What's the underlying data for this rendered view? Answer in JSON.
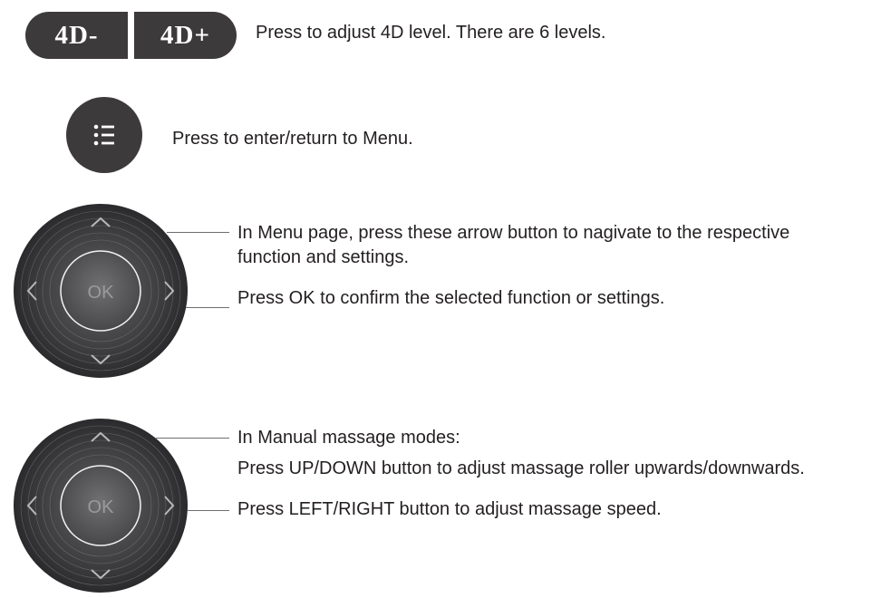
{
  "row_4d": {
    "minus_label": "4D-",
    "plus_label": "4D+",
    "description": "Press to adjust 4D level. There are 6 levels."
  },
  "row_menu": {
    "icon": "menu-list-icon",
    "description": "Press to enter/return to Menu."
  },
  "dpad_1": {
    "ok_label": "OK",
    "arrows": [
      "up",
      "down",
      "left",
      "right"
    ],
    "desc_nav_line1": "In Menu page, press these arrow button to nagivate to the respective",
    "desc_nav_line2": "function and settings.",
    "desc_ok": "Press OK to confirm the selected function or settings."
  },
  "dpad_2": {
    "ok_label": "OK",
    "arrows": [
      "up",
      "down",
      "left",
      "right"
    ],
    "desc_heading": "In Manual massage modes:",
    "desc_updown": "Press UP/DOWN button to adjust massage roller upwards/downwards.",
    "desc_leftright": "Press LEFT/RIGHT button to adjust massage speed."
  },
  "colors": {
    "button_fill": "#3d3a3b",
    "text": "#231f20",
    "leader_line": "#6d6e71"
  }
}
